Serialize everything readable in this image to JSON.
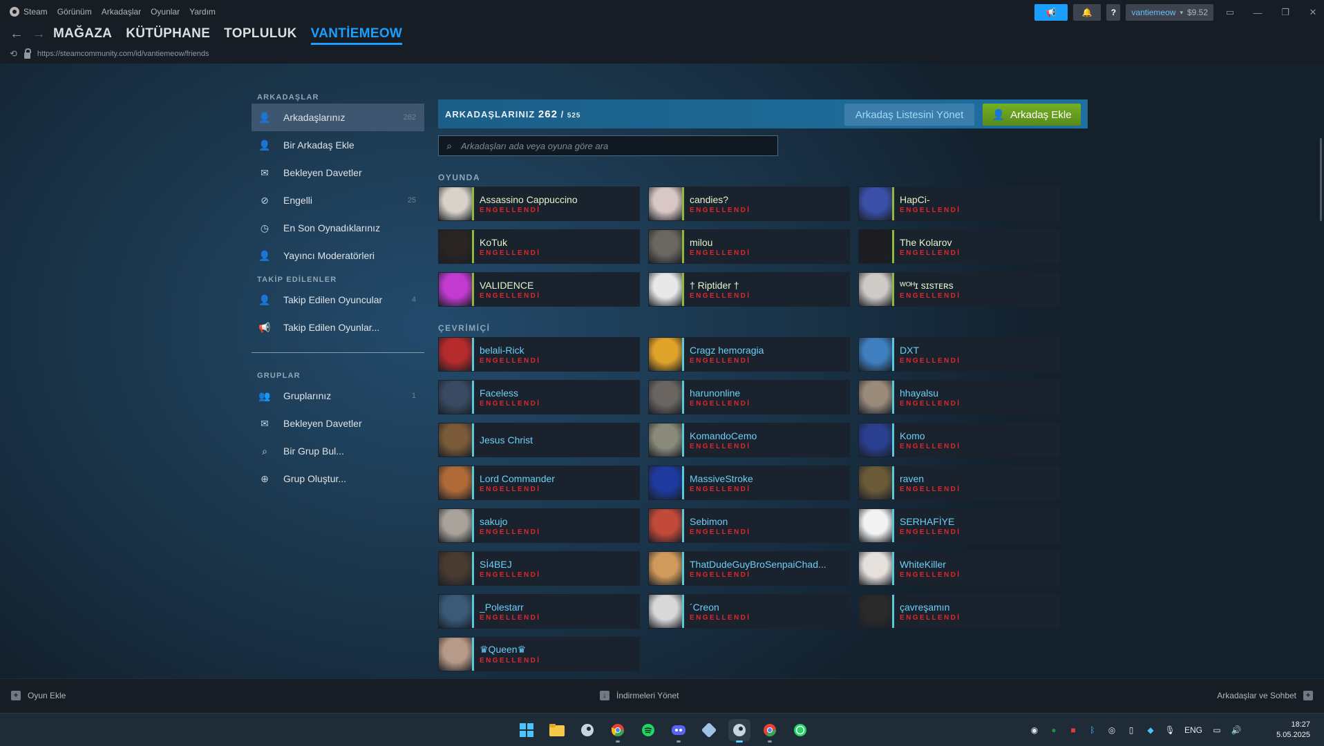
{
  "titlebar": {
    "menu": [
      "Steam",
      "Görünüm",
      "Arkadaşlar",
      "Oyunlar",
      "Yardım"
    ],
    "help": "?",
    "account_name": "vantiemeow",
    "wallet": "$9.52"
  },
  "nav": {
    "tabs": [
      "MAĞAZA",
      "KÜTÜPHANE",
      "TOPLULUK",
      "VANTİEMEOW"
    ],
    "url": "https://steamcommunity.com/id/vantiemeow/friends"
  },
  "sidebar": {
    "friends_heading": "ARKADAŞLAR",
    "friends_items": [
      {
        "label": "Arkadaşlarınız",
        "count": "262",
        "icon": "person-icon"
      },
      {
        "label": "Bir Arkadaş Ekle",
        "count": "",
        "icon": "person-add-icon"
      },
      {
        "label": "Bekleyen Davetler",
        "count": "",
        "icon": "envelope-icon"
      },
      {
        "label": "Engelli",
        "count": "25",
        "icon": "block-icon"
      },
      {
        "label": "En Son Oynadıklarınız",
        "count": "",
        "icon": "clock-icon"
      },
      {
        "label": "Yayıncı Moderatörleri",
        "count": "",
        "icon": "person-icon"
      }
    ],
    "following_heading": "TAKİP EDİLENLER",
    "following_items": [
      {
        "label": "Takip Edilen Oyuncular",
        "count": "4",
        "icon": "person-follow-icon"
      },
      {
        "label": "Takip Edilen Oyunlar...",
        "count": "",
        "icon": "megaphone-icon"
      }
    ],
    "groups_heading": "GRUPLAR",
    "groups_items": [
      {
        "label": "Gruplarınız",
        "count": "1",
        "icon": "group-icon"
      },
      {
        "label": "Bekleyen Davetler",
        "count": "",
        "icon": "envelope-icon"
      },
      {
        "label": "Bir Grup Bul...",
        "count": "",
        "icon": "search-icon"
      },
      {
        "label": "Grup Oluştur...",
        "count": "",
        "icon": "plus-circle-icon"
      }
    ]
  },
  "header": {
    "title_prefix": "ARKADAŞLARINIZ",
    "count": "262",
    "slash": "/",
    "limit": "525",
    "manage_button": "Arkadaş Listesini Yönet",
    "add_button": "Arkadaş Ekle"
  },
  "search": {
    "placeholder": "Arkadaşları ada veya oyuna göre ara"
  },
  "blocked_label": "ENGELLENDİ",
  "ingame": {
    "label": "OYUNDA",
    "friends": [
      {
        "name": "Assassino Cappuccino",
        "blocked": true,
        "avatar_color": "#d8d2c8"
      },
      {
        "name": "candies?",
        "blocked": true,
        "avatar_color": "#d9c7c4"
      },
      {
        "name": "HapCi-",
        "blocked": true,
        "avatar_color": "#3a4fa8"
      },
      {
        "name": "KoTuk",
        "blocked": true,
        "avatar_color": "#2a2422"
      },
      {
        "name": "milou",
        "blocked": true,
        "avatar_color": "#6b6660"
      },
      {
        "name": "The Kolarov",
        "blocked": true,
        "avatar_color": "#1c1c20"
      },
      {
        "name": "VALIDENCE",
        "blocked": true,
        "avatar_color": "#c23ad0"
      },
      {
        "name": "† Riptider †",
        "blocked": true,
        "avatar_color": "#e8e8e8"
      },
      {
        "name": "ᵂᴼᴴɪ sɪsᴛᴇʀs",
        "blocked": true,
        "avatar_color": "#cfcac6"
      }
    ]
  },
  "online": {
    "label": "ÇEVRİMİÇİ",
    "friends": [
      {
        "name": "belali-Rick",
        "blocked": true,
        "avatar_color": "#b52a2a"
      },
      {
        "name": "Cragz hemoragia",
        "blocked": true,
        "avatar_color": "#e0a32a"
      },
      {
        "name": "DXT",
        "blocked": true,
        "avatar_color": "#3f7fbf"
      },
      {
        "name": "Faceless",
        "blocked": true,
        "avatar_color": "#3a4a63"
      },
      {
        "name": "harunonline",
        "blocked": true,
        "avatar_color": "#6a6560"
      },
      {
        "name": "hhayalsu",
        "blocked": true,
        "avatar_color": "#9a8a7a"
      },
      {
        "name": "Jesus Christ",
        "blocked": false,
        "avatar_color": "#7a5a38"
      },
      {
        "name": "KomandoCemo",
        "blocked": true,
        "avatar_color": "#8a8a7a"
      },
      {
        "name": "Komo",
        "blocked": true,
        "avatar_color": "#2a3f8f"
      },
      {
        "name": "Lord Commander",
        "blocked": true,
        "avatar_color": "#b06a38"
      },
      {
        "name": "MassiveStroke",
        "blocked": true,
        "avatar_color": "#1f3a9f"
      },
      {
        "name": "raven",
        "blocked": true,
        "avatar_color": "#6a5a38"
      },
      {
        "name": "sakujo",
        "blocked": true,
        "avatar_color": "#a8a29a"
      },
      {
        "name": "Sebimon",
        "blocked": true,
        "avatar_color": "#c24a3a"
      },
      {
        "name": "SERHAFİYE",
        "blocked": true,
        "avatar_color": "#f2f2f2"
      },
      {
        "name": "Sİ4BEJ",
        "blocked": true,
        "avatar_color": "#4a3a30"
      },
      {
        "name": "ThatDudeGuyBroSenpaiChad...",
        "blocked": true,
        "avatar_color": "#d09a5a"
      },
      {
        "name": "WhiteKiller",
        "blocked": true,
        "avatar_color": "#e6e0dc"
      },
      {
        "name": "_Polestarr",
        "blocked": true,
        "avatar_color": "#3a5a7a"
      },
      {
        "name": "´Creon",
        "blocked": true,
        "avatar_color": "#d8d8d8"
      },
      {
        "name": "çavreşamın",
        "blocked": true,
        "avatar_color": "#2a2a2a"
      },
      {
        "name": "♛Queen♛",
        "blocked": true,
        "avatar_color": "#b89a88"
      }
    ]
  },
  "footer": {
    "add_game": "Oyun Ekle",
    "downloads": "İndirmeleri Yönet",
    "friends_chat": "Arkadaşlar ve Sohbet"
  },
  "taskbar": {
    "apps": [
      "windows-start-icon",
      "file-explorer-icon",
      "steam-icon",
      "chrome-icon",
      "spotify-icon",
      "discord-icon",
      "app-icon",
      "steam-active-icon",
      "chrome-profile-icon",
      "whatsapp-icon"
    ],
    "language": "ENG",
    "time": "18:27",
    "date": "5.05.2025"
  },
  "colors": {
    "accent": "#1a9fff",
    "ingame": "#90ba3c",
    "online": "#57cbde",
    "blocked": "#e0262b",
    "add_green": "#75b022"
  }
}
